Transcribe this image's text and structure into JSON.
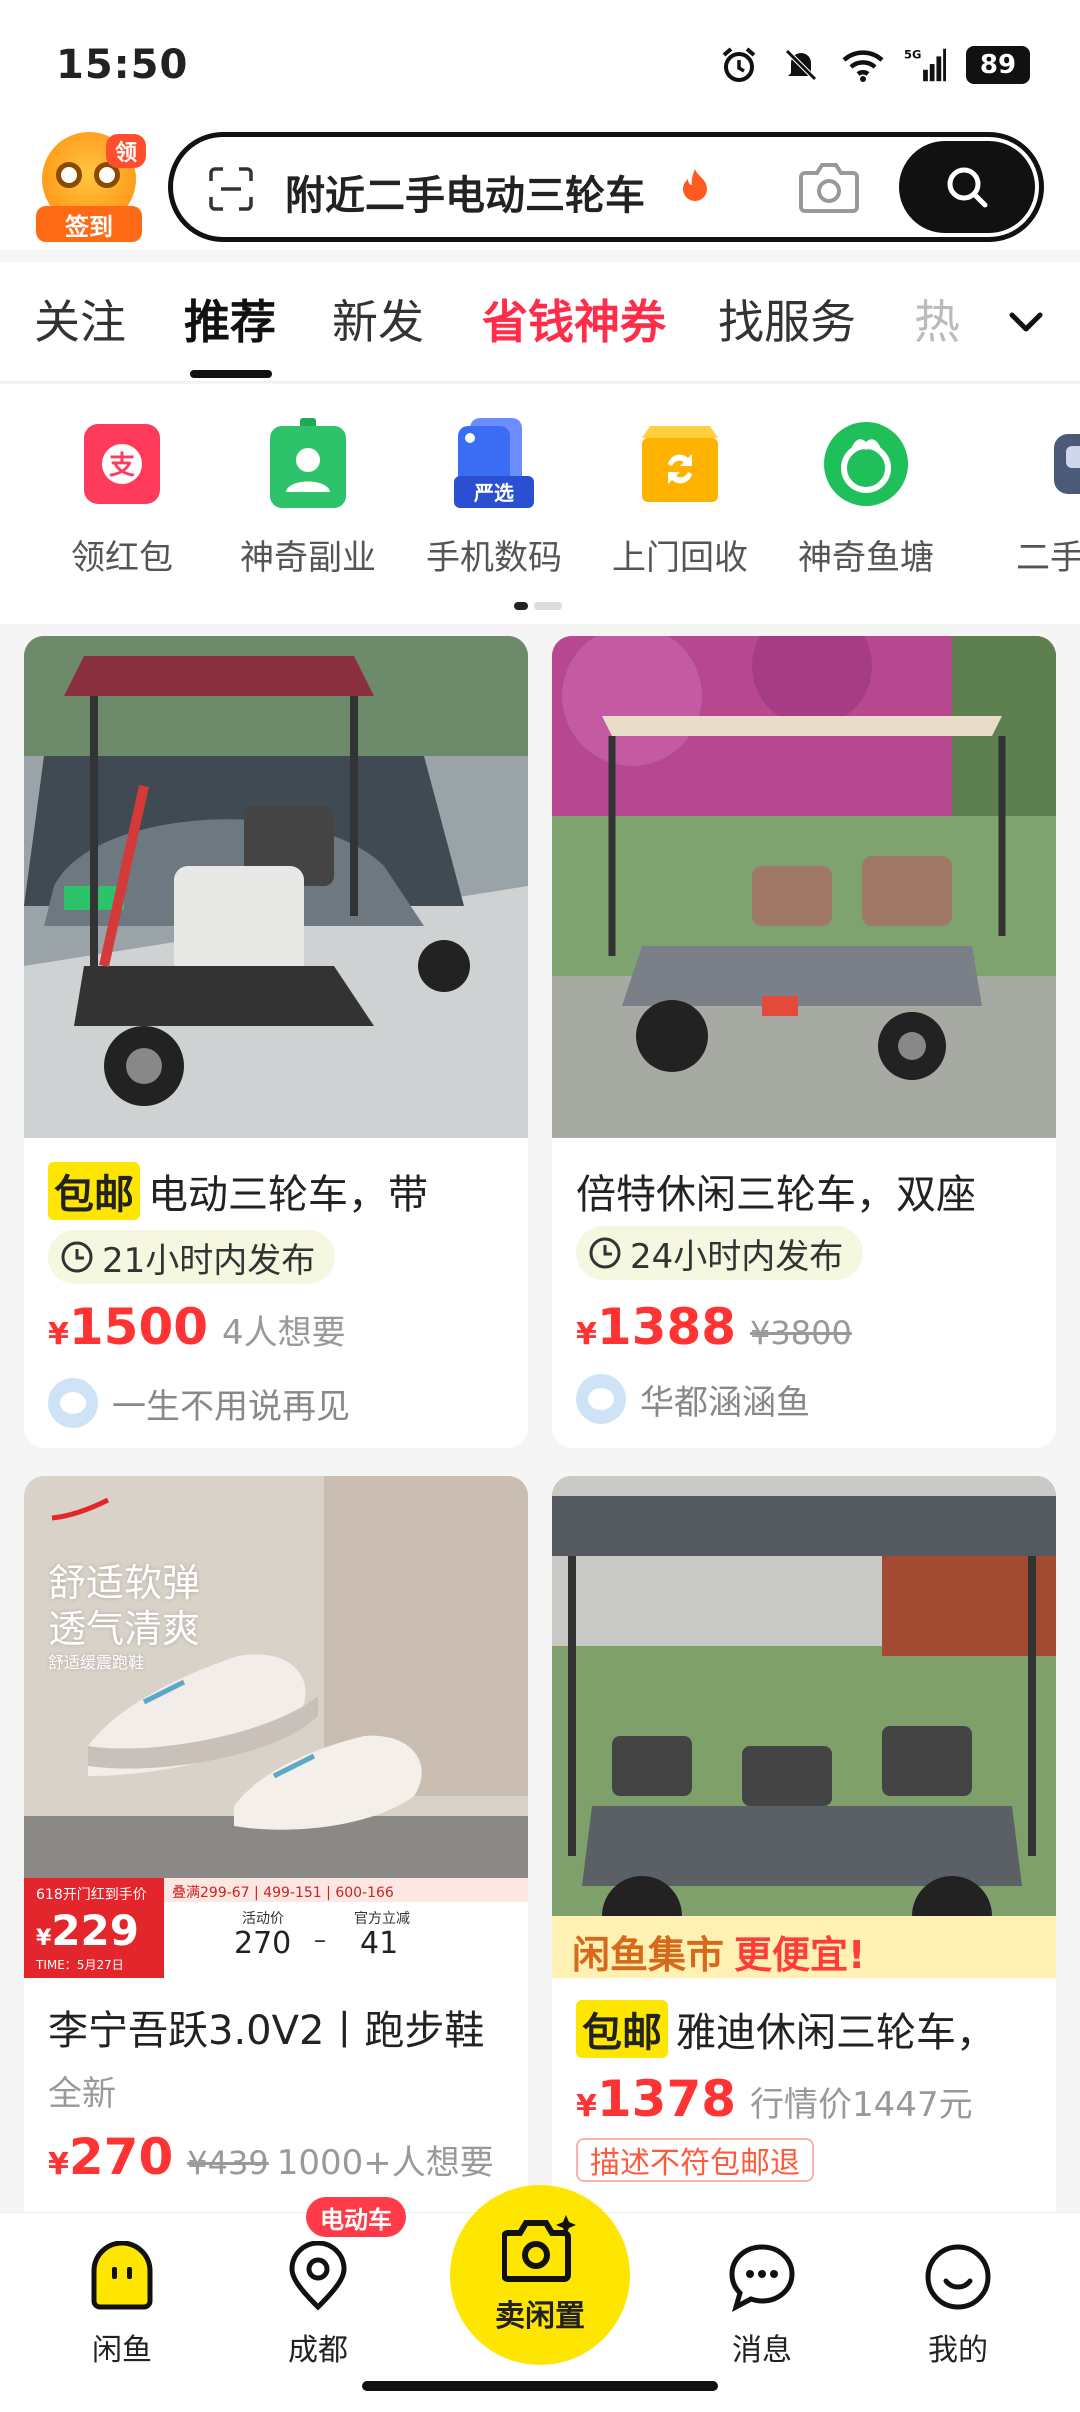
{
  "status_bar": {
    "time": "15:50",
    "battery": "89",
    "network": "5G"
  },
  "header": {
    "signin_badge": "领",
    "signin_label": "签到",
    "search_text": "附近二手电动三轮车"
  },
  "tabs": [
    {
      "label": "关注"
    },
    {
      "label": "推荐"
    },
    {
      "label": "新发"
    },
    {
      "label": "省钱神券"
    },
    {
      "label": "找服务"
    },
    {
      "label": "热"
    }
  ],
  "shortcuts": [
    {
      "label": "领红包",
      "icon": "red-packet-icon",
      "color": "#ff3b5c"
    },
    {
      "label": "神奇副业",
      "icon": "id-badge-icon",
      "color": "#2ec26a"
    },
    {
      "label": "手机数码",
      "icon": "phone-icon",
      "color": "#3a6cf4",
      "badge": "严选"
    },
    {
      "label": "上门回收",
      "icon": "recycle-box-icon",
      "color": "#ffb300"
    },
    {
      "label": "神奇鱼塘",
      "icon": "fish-pond-icon",
      "color": "#1fbf5a"
    },
    {
      "label": "二手",
      "icon": "car-icon",
      "color": "#4a5a78"
    }
  ],
  "cards": [
    {
      "baoyou": "包邮",
      "title": "电动三轮车，带",
      "posted": "21小时内发布",
      "price": "1500",
      "want": "4人想要",
      "seller": "一生不用说再见"
    },
    {
      "title": "倍特休闲三轮车，双座",
      "posted": "24小时内发布",
      "price": "1388",
      "old_price": "¥3800",
      "seller": "华都涵涵鱼"
    },
    {
      "title": "李宁吾跃3.0V2丨跑步鞋",
      "subtitle": "全新",
      "price": "270",
      "old_price": "¥439",
      "want": "1000+人想要",
      "ad_lines": [
        "舒适软弹",
        "透气清爽"
      ],
      "ad_small": "舒适缓震跑鞋",
      "promo_event": "618开门红到手价",
      "promo_price": "229",
      "promo_time": "TIME：5月27日",
      "promo_deals": "叠满299-67 | 499-151 | 600-166",
      "promo_act_label": "活动价",
      "promo_act": "270",
      "promo_dash": "–",
      "promo_off_label": "官方立减",
      "promo_off": "41"
    },
    {
      "banner": "闲鱼集市",
      "banner_red": "更便宜!",
      "baoyou": "包邮",
      "title": "雅迪休闲三轮车，",
      "price": "1378",
      "market": "行情价1447元",
      "tag": "描述不符包邮退"
    }
  ],
  "currency": "¥",
  "bottom_nav": {
    "home": "闲鱼",
    "city": "成都",
    "city_badge": "电动车",
    "sell": "卖闲置",
    "messages": "消息",
    "me": "我的"
  },
  "colors": {
    "accent_yellow": "#ffe600",
    "price_red": "#ff3333",
    "tab_red": "#ff2d4a"
  }
}
